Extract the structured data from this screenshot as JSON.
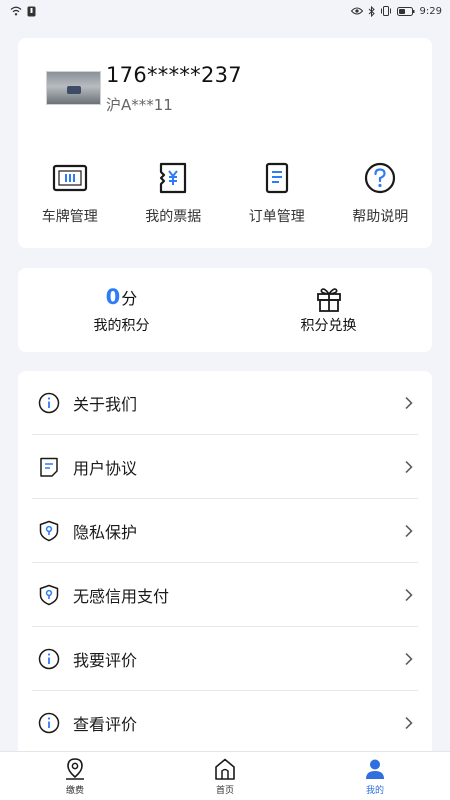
{
  "status_bar": {
    "time": "9:29",
    "icons": [
      "wifi-icon",
      "notification-icon",
      "eye-icon",
      "bluetooth-icon",
      "vibrate-icon",
      "battery-icon"
    ]
  },
  "profile": {
    "phone": "176*****237",
    "plate": "沪A***11"
  },
  "quick_actions": [
    {
      "label": "车牌管理",
      "icon": "license-plate-icon"
    },
    {
      "label": "我的票据",
      "icon": "receipt-icon"
    },
    {
      "label": "订单管理",
      "icon": "order-icon"
    },
    {
      "label": "帮助说明",
      "icon": "help-icon"
    }
  ],
  "points": {
    "value": "0",
    "unit": "分",
    "label": "我的积分",
    "exchange_label": "积分兑换"
  },
  "menu": [
    {
      "label": "关于我们",
      "icon": "info-icon"
    },
    {
      "label": "用户协议",
      "icon": "document-icon"
    },
    {
      "label": "隐私保护",
      "icon": "shield-icon"
    },
    {
      "label": "无感信用支付",
      "icon": "shield-icon"
    },
    {
      "label": "我要评价",
      "icon": "info-icon"
    },
    {
      "label": "查看评价",
      "icon": "info-icon"
    }
  ],
  "tabs": [
    {
      "label": "缴费",
      "icon": "location-pin-icon"
    },
    {
      "label": "首页",
      "icon": "home-icon"
    },
    {
      "label": "我的",
      "icon": "person-icon",
      "active": true
    }
  ],
  "colors": {
    "accent": "#2f7cf6",
    "active_tab": "#2f6fe0",
    "background": "#f2f4f9"
  }
}
